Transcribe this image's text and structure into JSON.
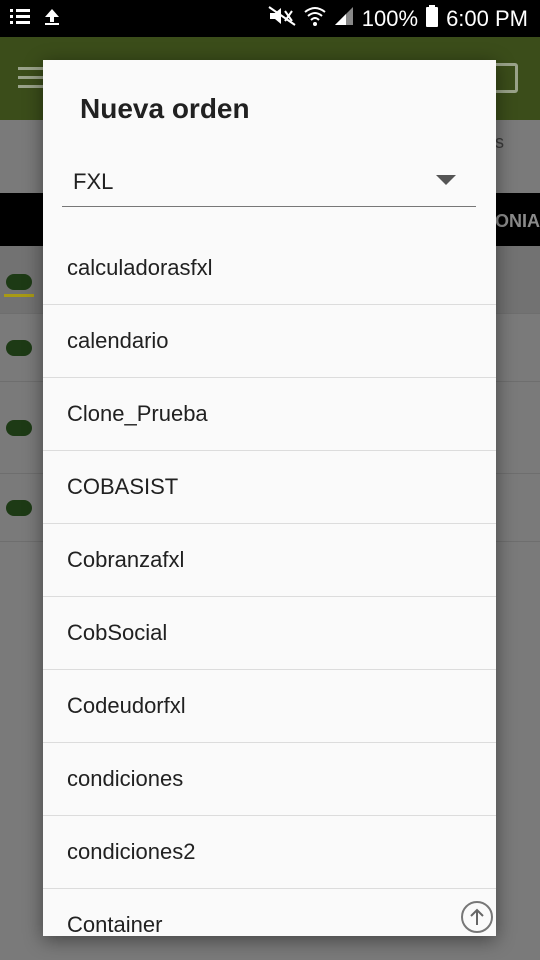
{
  "status_bar": {
    "battery": "100%",
    "time": "6:00 PM"
  },
  "background": {
    "tab_fragment": "s",
    "column_header_fragment": "LONIA"
  },
  "dialog": {
    "title": "Nueva orden",
    "spinner_value": "FXL",
    "items": [
      "calculadorasfxl",
      "calendario",
      "Clone_Prueba",
      "COBASIST",
      "Cobranzafxl",
      "CobSocial",
      "Codeudorfxl",
      "condiciones",
      "condiciones2",
      "Container"
    ]
  },
  "colors": {
    "app_bar": "#3b4d1a",
    "dialog_bg": "#fafafa",
    "divider": "#dcdcdc"
  }
}
